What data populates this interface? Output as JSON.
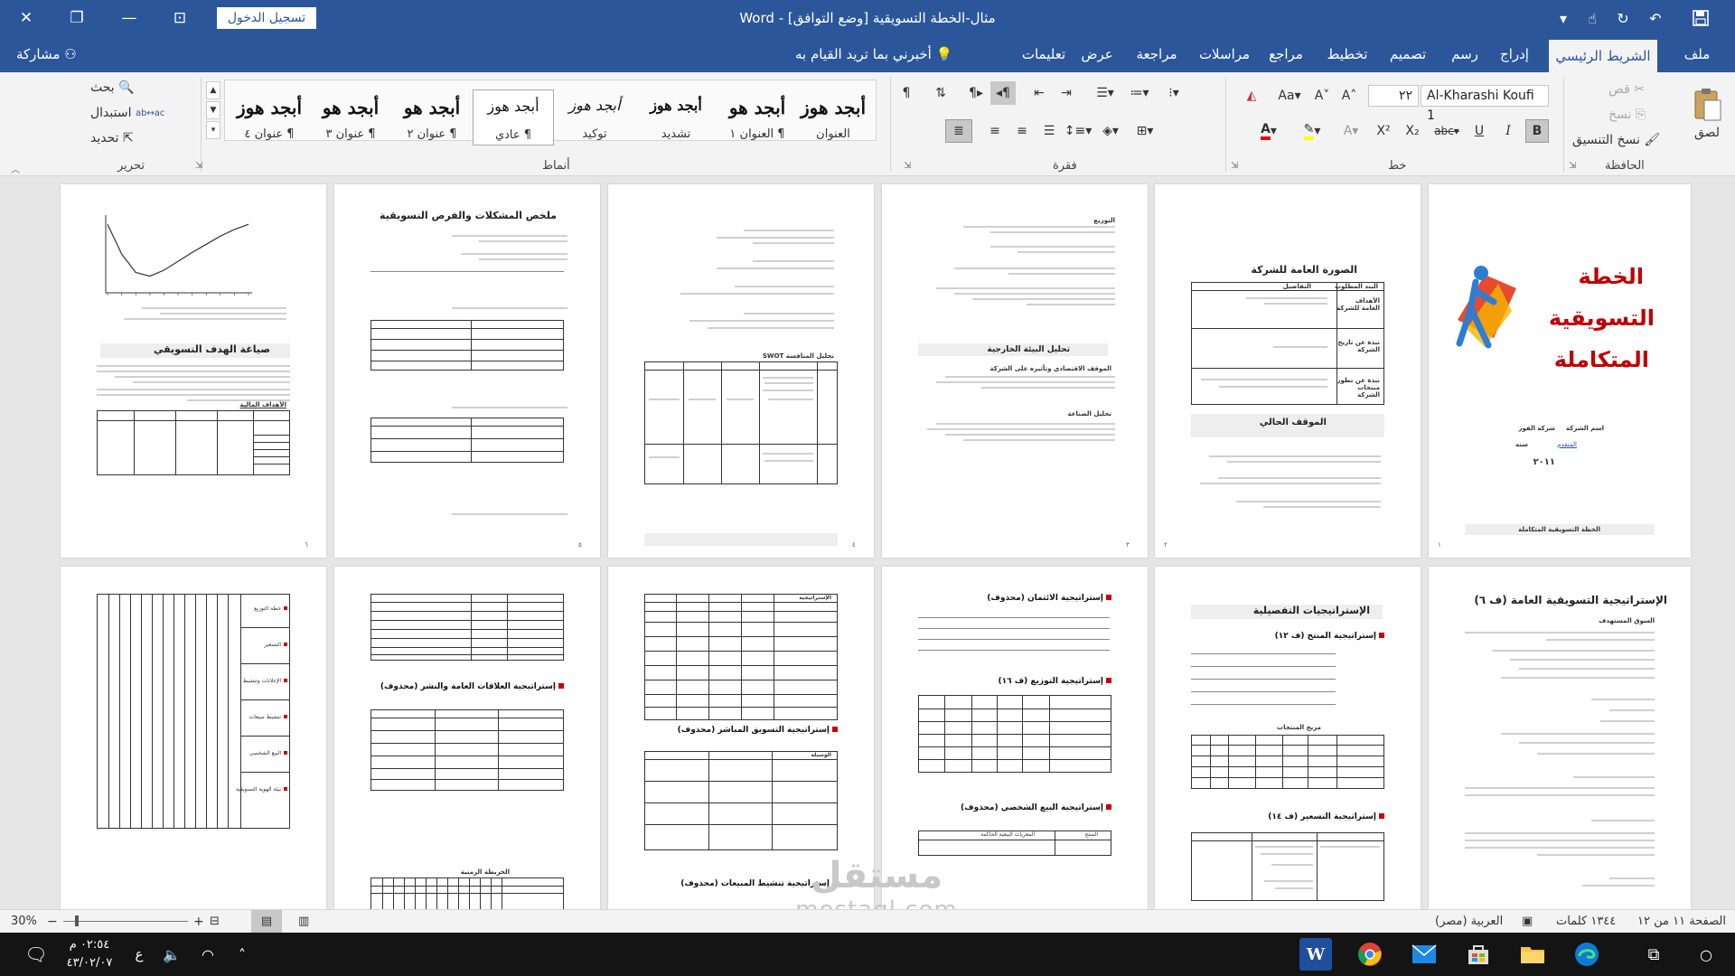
{
  "app": {
    "name": "Word"
  },
  "titlebar": {
    "doc_title": "مثال-الخطة التسويقية [وضع التوافق]  -  Word",
    "signin_label": "تسجيل الدخول",
    "close_glyph": "✕",
    "restore_glyph": "❐",
    "minimize_glyph": "—",
    "ribbon_display_glyph": "⊡"
  },
  "tabs": [
    {
      "label": "ملف"
    },
    {
      "label": "الشريط الرئيسي"
    },
    {
      "label": "إدراج"
    },
    {
      "label": "رسم"
    },
    {
      "label": "تصميم"
    },
    {
      "label": "تخطيط"
    },
    {
      "label": "مراجع"
    },
    {
      "label": "مراسلات"
    },
    {
      "label": "مراجعة"
    },
    {
      "label": "عرض"
    },
    {
      "label": "تعليمات"
    }
  ],
  "tell_me": "أخبرني بما تريد القيام به",
  "share_label": "مشاركة",
  "ribbon": {
    "clipboard": {
      "label": "الحافظة",
      "paste": "لصق",
      "cut": "قص",
      "copy": "نسخ",
      "format_painter": "نسخ التنسيق"
    },
    "font": {
      "label": "خط",
      "font_name": "Al-Kharashi Koufi 1",
      "font_size": "٢٢"
    },
    "paragraph": {
      "label": "فقرة"
    },
    "styles": {
      "label": "أنماط",
      "items": [
        {
          "sample": "أبجد هوز",
          "name": "العنوان"
        },
        {
          "sample": "أبجد هو",
          "name": "¶ العنوان ١"
        },
        {
          "sample": "أبجد هوز",
          "name": "تشديد"
        },
        {
          "sample": "أبجد هوز",
          "name": "توكيد"
        },
        {
          "sample": "أبجد هوز",
          "name": "¶ عادي"
        },
        {
          "sample": "أبجد هو",
          "name": "¶ عنوان ٢"
        },
        {
          "sample": "أبجد هو",
          "name": "¶ عنوان ٣"
        },
        {
          "sample": "أبجد هوز",
          "name": "¶ عنوان ٤"
        }
      ]
    },
    "editing": {
      "label": "تحرير",
      "find": "بحث",
      "replace": "استبدال",
      "select": "تحديد"
    }
  },
  "pages": {
    "p1": {
      "title_line1": "الخطة",
      "title_line2": "التسويقية",
      "title_line3": "المتكاملة",
      "company_label": "اسم الشركة",
      "company_name": "شركة الفوز",
      "prepared": "المتقدم",
      "year_label": "سنة",
      "year": "٢٠١١",
      "footer": "الخطة التسويقية المتكاملة",
      "num": "١"
    },
    "p2": {
      "heading": "الصورة العامة للشركة",
      "col1": "البند المطلوب",
      "col2": "التفاصيل",
      "row1": "الأهداف العامة للشركة",
      "row2": "نبذة عن تاريخ الشركة",
      "row3": "نبذة عن تطور منتجات الشركة",
      "heading2": "الموقف الحالي",
      "num": "٢"
    },
    "p3": {
      "top": "التوزيع",
      "heading": "تحليل البيئة الخارجية",
      "sub1": "الموقف الاقتصادي وتأثيره على الشركة",
      "sub2": "تحليل الصناعة",
      "num": "٣"
    },
    "p4": {
      "swot": "تحليل المنافسة SWOT",
      "num": "٤"
    },
    "p5": {
      "heading": "ملخص المشكلات والفرص التسويقية",
      "num": "٥"
    },
    "p6": {
      "heading": "صياغة الهدف التسويقي",
      "sub": "الأهداف المالية",
      "num": "٦"
    },
    "p7": {
      "heading": "الإستراتيجية التسويقية العامة (ف ٦)",
      "sub": "السوق المستهدف"
    },
    "p8": {
      "heading": "الإستراتيجيات التفصيلية",
      "sub1": "إستراتيجية المنتج (ف ١٢)",
      "sub2": "مزيج المنتجات",
      "sub3": "إستراتيجية التسعير (ف ١٤)"
    },
    "p9": {
      "sub1": "إستراتيجية الائتمان (محذوف)",
      "sub2": "إستراتيجية التوزيع (ف ١٦)",
      "sub3": "إستراتيجية البيع الشخصي (محذوف)",
      "tbl_col1": "المنتج",
      "tbl_col2": "المغريات البيعية الحاكمة"
    },
    "p10": {
      "tbl_head": "الإستراتيجية",
      "sub1": "إستراتيجية التسويق المباشر (محذوف)",
      "tbl2_head": "الوسيلة",
      "sub2": "إستراتيجية تنشيط المبيعات (محذوف)"
    },
    "p11": {
      "sub1": "إستراتيجية العلاقات العامة والنشر (محذوف)",
      "sub2": "الخريطة الزمنية"
    },
    "p12": {
      "items": [
        "خطة التوزيع",
        "التسعير",
        "الإعلانات وتنشيط",
        "تنشيط مبيعات",
        "البيع الشخصي",
        "بيئة الهوية التسويقية"
      ]
    }
  },
  "chart_data": {
    "type": "line",
    "title": "",
    "xlabel": "",
    "ylabel": "",
    "x": [
      0,
      1,
      2,
      3,
      4,
      5,
      6,
      7,
      8,
      9,
      10
    ],
    "series": [
      {
        "values": [
          9,
          5,
          2.5,
          2,
          2.8,
          4,
          5.2,
          6.3,
          7.4,
          8.3,
          9
        ]
      }
    ],
    "ylim": [
      0,
      10
    ],
    "grid": false
  },
  "statusbar": {
    "page_info": "الصفحة ١١ من ١٢",
    "word_count": "١٣٤٤ كلمات",
    "language": "العربية (مصر)",
    "zoom": "30%",
    "zoom_level": 0.3
  },
  "taskbar": {
    "time": "٠٢:٥٤ م",
    "date": "٤٣/٠٢/٠٧",
    "lang": "ع",
    "watermark_ar": "مستقل",
    "watermark_en": "mostaql.com"
  },
  "colors": {
    "word_blue": "#2b579a",
    "ribbon_bg": "#f3f3f3",
    "doc_bg": "#e6e6e6",
    "title_red": "#c00000"
  }
}
